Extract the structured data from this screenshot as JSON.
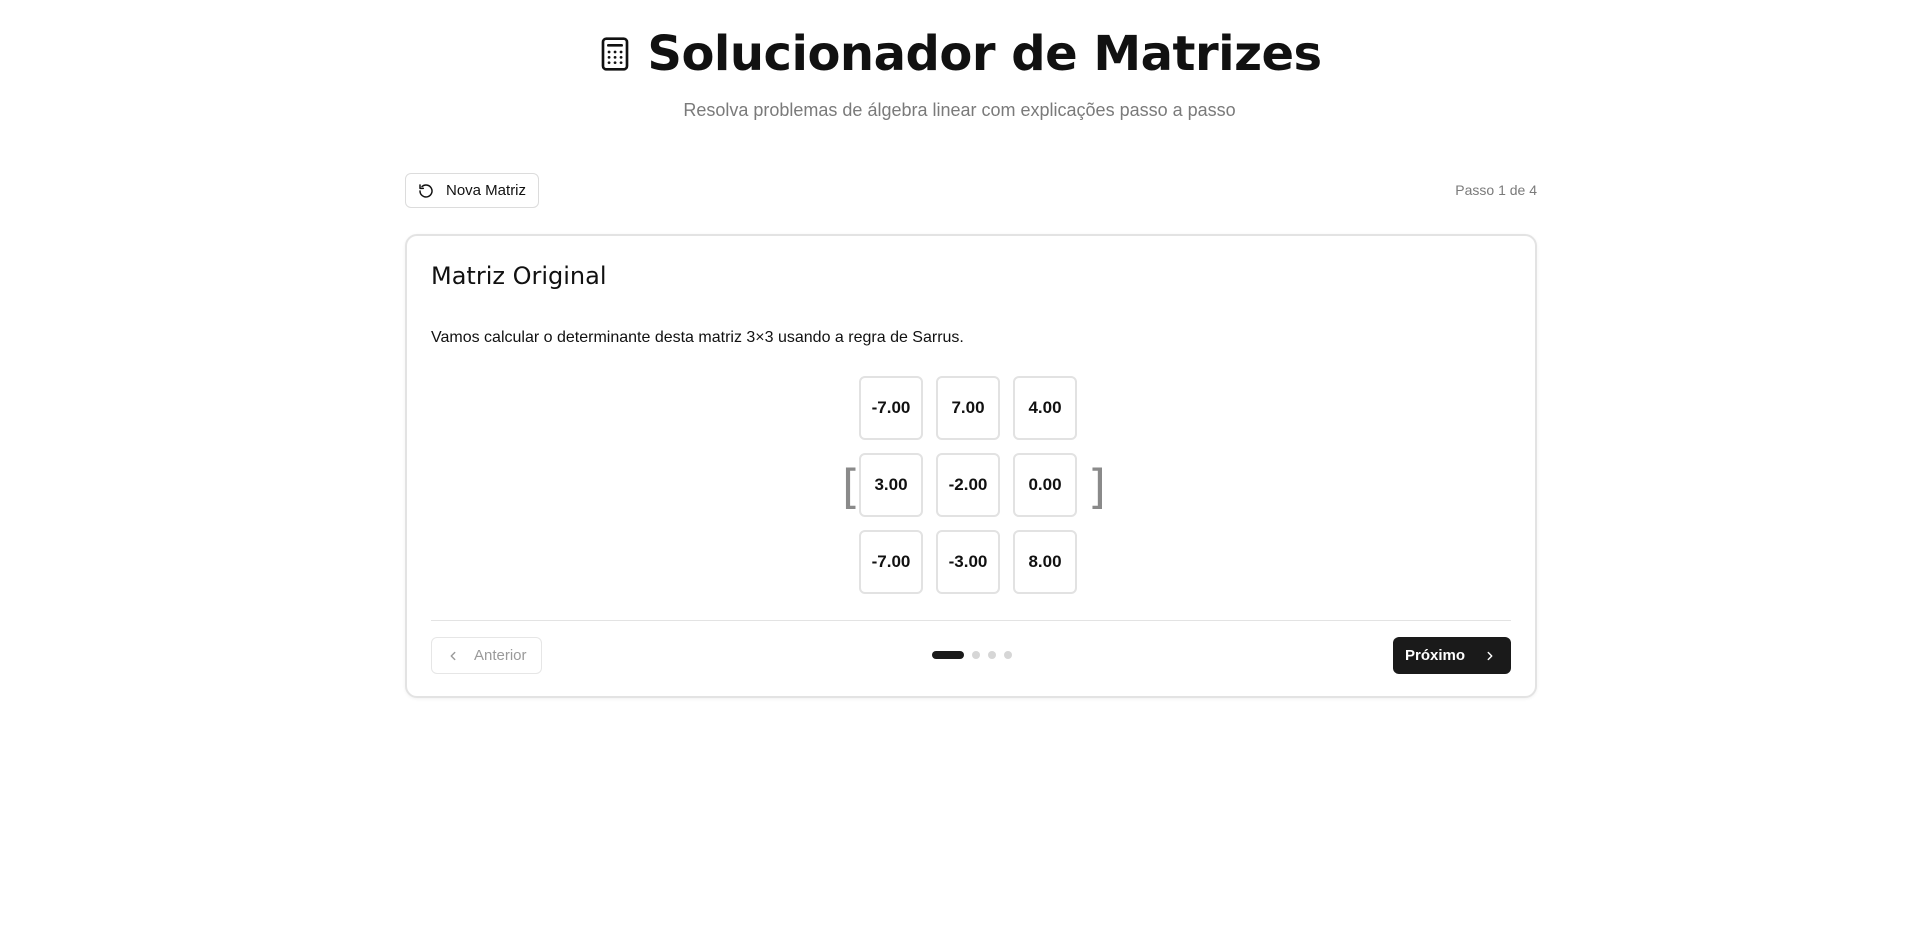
{
  "header": {
    "title": "Solucionador de Matrizes",
    "subtitle": "Resolva problemas de álgebra linear com explicações passo a passo",
    "icon": "calculator-icon"
  },
  "toolbar": {
    "new_matrix_label": "Nova Matriz",
    "new_matrix_icon": "refresh-icon",
    "step_indicator": "Passo 1 de 4"
  },
  "card": {
    "title": "Matriz Original",
    "description": "Vamos calcular o determinante desta matriz 3×3 usando a regra de Sarrus.",
    "matrix": [
      [
        "-7.00",
        "7.00",
        "4.00"
      ],
      [
        "3.00",
        "-2.00",
        "0.00"
      ],
      [
        "-7.00",
        "-3.00",
        "8.00"
      ]
    ],
    "left_bracket": "[",
    "right_bracket": "]"
  },
  "navigation": {
    "prev_label": "Anterior",
    "next_label": "Próximo",
    "total_steps": 4,
    "current_step": 1
  },
  "colors": {
    "primary": "#1a1a1a",
    "muted_text": "#7a7a7a",
    "border": "#e3e3e3",
    "dot_inactive": "#d6d6d6"
  }
}
